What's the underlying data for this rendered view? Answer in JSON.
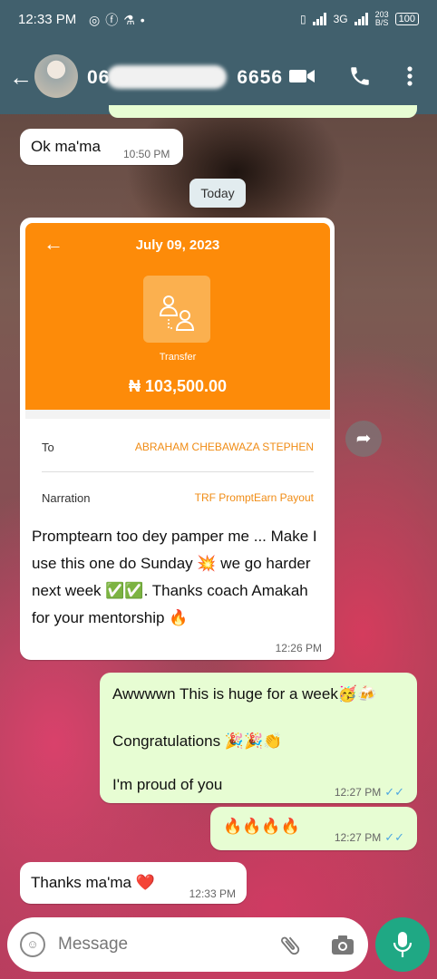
{
  "status_bar": {
    "time": "12:33 PM",
    "network": "3G",
    "speed_value": "203",
    "speed_unit": "B/S",
    "battery": "100"
  },
  "header": {
    "contact_name": "06",
    "contact_name_suffix": "6656"
  },
  "messages": [
    {
      "type": "incoming",
      "text": "Ok ma'ma",
      "time": "10:50 PM"
    },
    {
      "type": "date_chip",
      "text": "Today"
    },
    {
      "type": "incoming_receipt",
      "receipt": {
        "date": "July 09, 2023",
        "icon_label": "Transfer",
        "amount": "₦ 103,500.00",
        "to_label": "To",
        "to_value": "ABRAHAM CHEBAWAZA STEPHEN",
        "narration_label": "Narration",
        "narration_value": "TRF PromptEarn Payout"
      },
      "text": "Promptearn too dey pamper me ... Make I use this one do Sunday 💥 we go harder next week ✅✅. Thanks coach Amakah for your mentorship 🔥",
      "time": "12:26 PM"
    },
    {
      "type": "outgoing",
      "lines": [
        "Awwwwn This is huge for a week🥳🍻",
        "Congratulations 🎉🎉👏",
        "I'm proud of you"
      ],
      "time": "12:27 PM",
      "status": "read"
    },
    {
      "type": "outgoing",
      "text": "🔥🔥🔥🔥",
      "time": "12:27 PM",
      "status": "read"
    },
    {
      "type": "incoming",
      "text": "Thanks ma'ma ❤️",
      "time": "12:33 PM"
    }
  ],
  "input": {
    "placeholder": "Message"
  },
  "icons": [
    "back-arrow-icon",
    "video-call-icon",
    "phone-icon",
    "more-vert-icon",
    "forward-icon",
    "emoji-icon",
    "attach-icon",
    "camera-icon",
    "mic-icon",
    "double-check-icon"
  ],
  "colors": {
    "header": "#41606d",
    "outgoing_bubble": "#e7fdd3",
    "incoming_bubble": "#ffffff",
    "receipt_orange": "#fd8b09",
    "mic_button": "#1fa884",
    "read_ticks": "#4fa8e0"
  }
}
